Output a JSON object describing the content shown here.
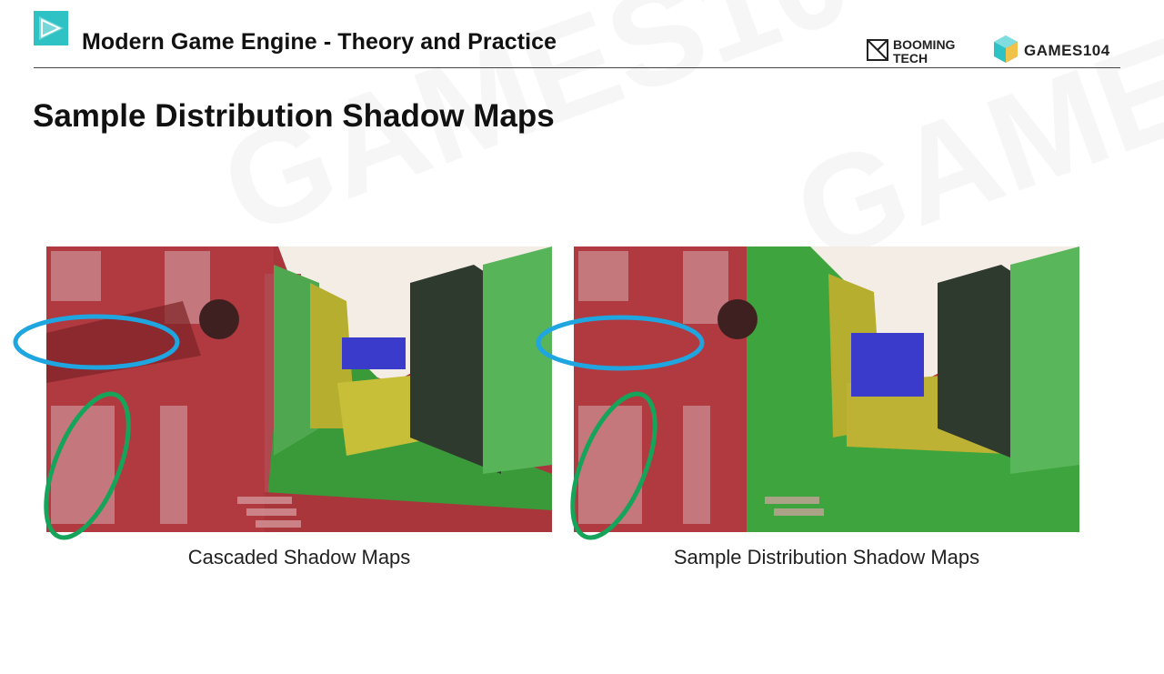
{
  "header": {
    "title": "Modern Game Engine - Theory and Practice",
    "brand_booming": "BOOMING TECH",
    "brand_games": "GAMES104",
    "logo_icon": "play-triangle-icon"
  },
  "slide": {
    "title": "Sample Distribution Shadow Maps"
  },
  "panels": [
    {
      "caption": "Cascaded Shadow Maps"
    },
    {
      "caption": "Sample Distribution Shadow Maps"
    }
  ],
  "colors": {
    "cascade_red": "#b23a3e",
    "cascade_green": "#3fae3f",
    "cascade_yellow": "#b9b12e",
    "cascade_blue": "#3a3acb",
    "highlight_blue": "#1fa6e0",
    "highlight_green": "#16a35a",
    "logo_teal": "#2fc2c5"
  }
}
